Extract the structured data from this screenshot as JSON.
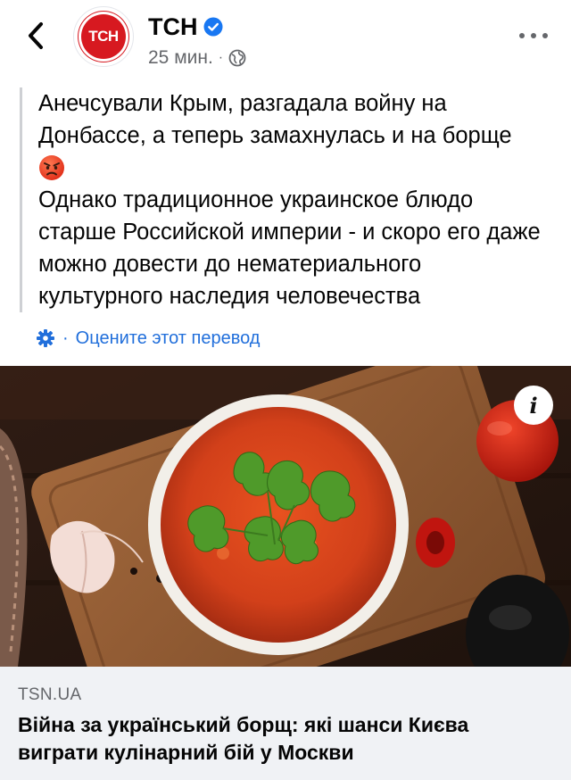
{
  "post": {
    "page_name": "ТСН",
    "avatar_text": "ТСН",
    "time": "25 мин.",
    "separator": "·",
    "text_line1": "Анечсували Крым, разгадала войну на Донбассе, а теперь замахнулась и на борще",
    "text_line2": "Однако традиционное украинское блюдо старше Российской империи - и скоро его даже можно довести до нематериального культурного наследия человечества",
    "emoji": "angry-face-emoji",
    "rate_separator": "·",
    "rate_translation_label": "Оцените этот перевод"
  },
  "link": {
    "domain": "TSN.UA",
    "title": "Війна за український борщ: які шанси Києва виграти кулінарний бій у Москви",
    "info_label": "i"
  },
  "colors": {
    "brand_red": "#d71920",
    "link_blue": "#216fdb",
    "verified_blue": "#1877f2",
    "muted_text": "#65676b",
    "card_bg": "#f0f2f5"
  },
  "icons": [
    "back-chevron-icon",
    "verified-badge-icon",
    "globe-icon",
    "more-dots-icon",
    "gear-icon",
    "info-icon"
  ]
}
